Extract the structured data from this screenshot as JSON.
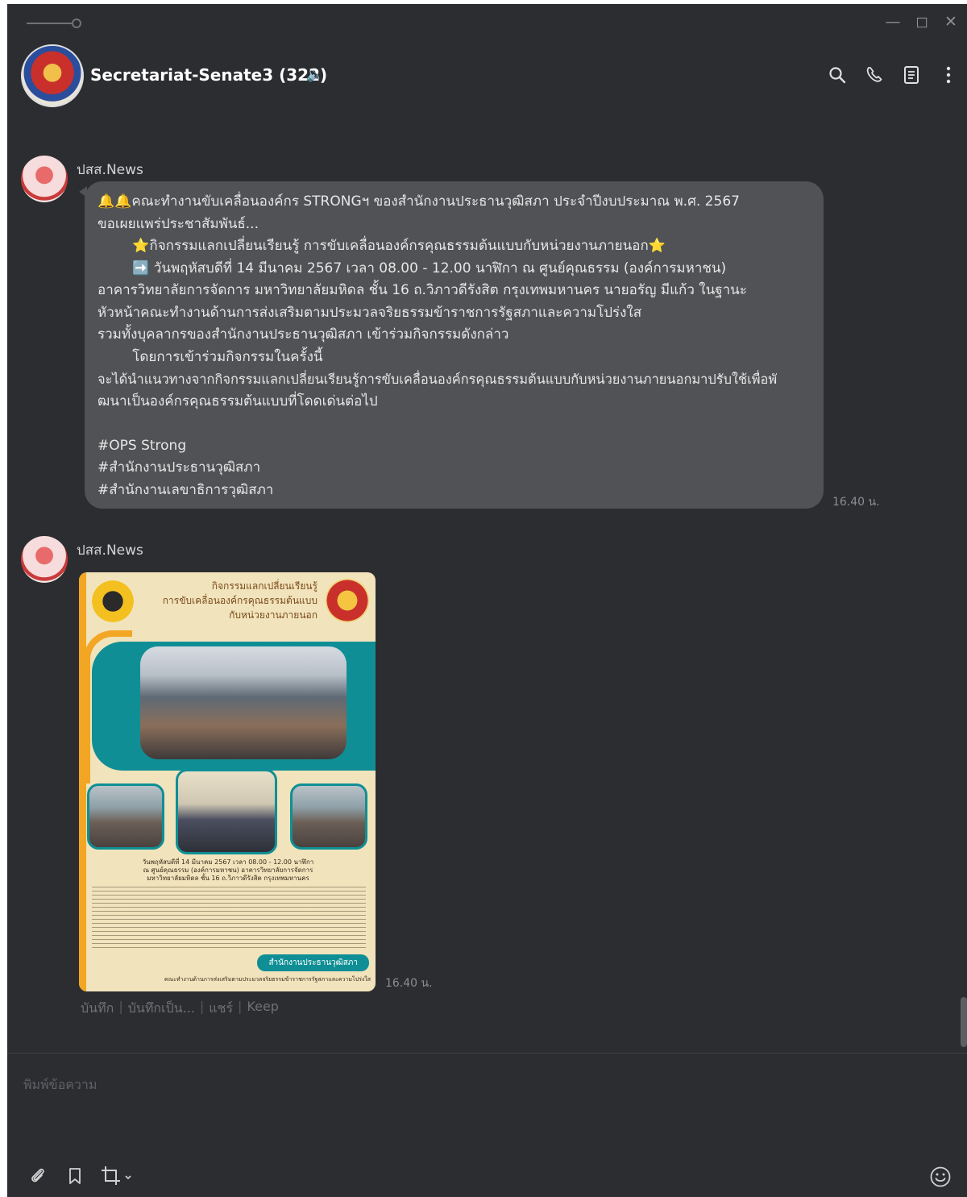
{
  "chat": {
    "title": "Secretariat-Senate3",
    "member_count": "(322)"
  },
  "messages": [
    {
      "sender": "ปสส.News",
      "lines": [
        "🔔🔔คณะทำงานขับเคลื่อนองค์กร STRONGฯ ของสำนักงานประธานวุฒิสภา ประจำปีงบประมาณ พ.ศ. 2567",
        "ขอเผยแพร่ประชาสัมพันธ์...",
        "        ⭐กิจกรรมแลกเปลี่ยนเรียนรู้ การขับเคลื่อนองค์กรคุณธรรมต้นแบบกับหน่วยงานภายนอก⭐",
        "        ➡️ วันพฤหัสบดีที่ 14 มีนาคม 2567 เวลา 08.00 - 12.00 นาฬิกา ณ ศูนย์คุณธรรม (องค์การมหาชน)",
        "อาคารวิทยาลัยการจัดการ มหาวิทยาลัยมหิดล ชั้น 16 ถ.วิภาวดีรังสิต กรุงเทพมหานคร  นายอรัญ มีแก้ว ในฐานะ",
        "หัวหน้าคณะทำงานด้านการส่งเสริมตามประมวลจริยธรรมข้าราชการรัฐสภาและความโปร่งใส",
        "รวมทั้งบุคลากรของสำนักงานประธานวุฒิสภา เข้าร่วมกิจกรรมดังกล่าว",
        "        โดยการเข้าร่วมกิจกรรมในครั้งนี้",
        "จะได้นำแนวทางจากกิจกรรมแลกเปลี่ยนเรียนรู้การขับเคลื่อนองค์กรคุณธรรมต้นแบบกับหน่วยงานภายนอกมาปรับใช้เพื่อพั",
        "ฒนาเป็นองค์กรคุณธรรมต้นแบบที่โดดเด่นต่อไป",
        "",
        "#OPS Strong",
        "#สำนักงานประธานวุฒิสภา",
        "#สำนักงานเลขาธิการวุฒิสภา"
      ],
      "time": "16.40 น."
    },
    {
      "sender": "ปสส.News",
      "poster": {
        "title_lines": [
          "กิจกรรมแลกเปลี่ยนเรียนรู้",
          "การขับเคลื่อนองค์กรคุณธรรมต้นแบบ",
          "กับหน่วยงานภายนอก"
        ],
        "caption_lines": [
          "วันพฤหัสบดีที่ 14 มีนาคม 2567 เวลา 08.00 - 12.00 นาฬิกา",
          "ณ ศูนย์คุณธรรม (องค์การมหาชน) อาคารวิทยาลัยการจัดการ",
          "มหาวิทยาลัยมหิดล ชั้น 16 ถ.วิภาวดีรังสิต กรุงเทพมหานคร"
        ],
        "org": "สำนักงานประธานวุฒิสภา",
        "footer": "คณะทำงานด้านการส่งเสริมตามประมวลจริยธรรมข้าราชการรัฐสภาและความโปร่งใส"
      },
      "time": "16.40 น.",
      "actions": [
        "บันทึก",
        "บันทึกเป็น...",
        "แชร์",
        "Keep"
      ]
    }
  ],
  "composer": {
    "placeholder": "พิมพ์ข้อความ"
  },
  "icons": {
    "header": [
      "search-icon",
      "phone-icon",
      "notes-icon",
      "more-icon"
    ],
    "window": [
      "minimize-icon",
      "maximize-icon",
      "close-icon"
    ],
    "composer": [
      "attach-icon",
      "bookmark-icon",
      "crop-icon",
      "emoji-icon"
    ]
  }
}
